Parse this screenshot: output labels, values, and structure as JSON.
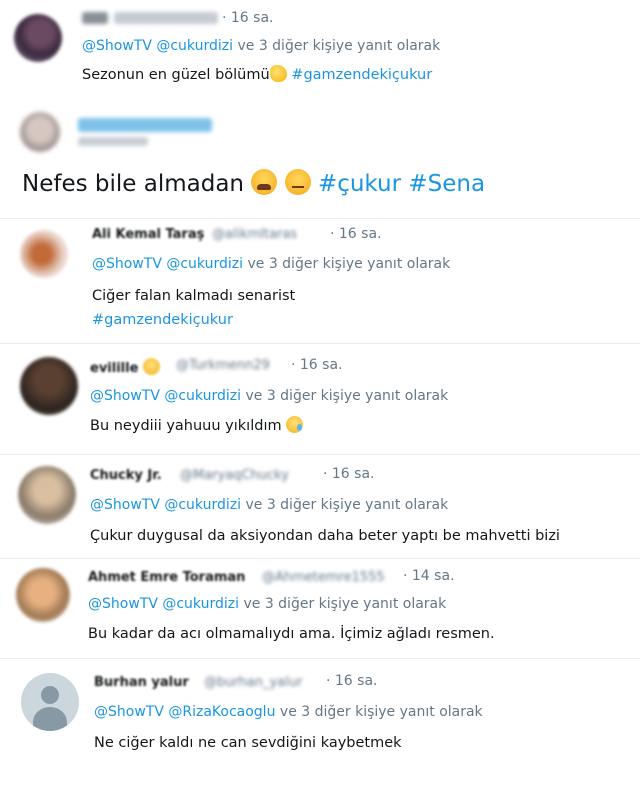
{
  "reply_prefix": "@ShowTV",
  "reply_suffix": "ve 3 diğer kişiye yanıt olarak",
  "tweets": [
    {
      "time": "· 16 sa.",
      "mention2": "@cukurdizi",
      "text": "Sezonun en güzel bölümü",
      "hashtag": "#gamzendekiçukur",
      "emoji": "clapping-hands-icon"
    },
    {
      "text": "Nefes bile almadan",
      "hashtags": [
        "#çukur",
        "#Sena"
      ],
      "emojis": [
        "weary-face-icon",
        "unamused-face-icon"
      ]
    },
    {
      "name": "Ali Kemal Taraş",
      "handle": "@alikmltaras",
      "time": "· 16 sa.",
      "mention2": "@cukurdizi",
      "text": "Ciğer falan kalmadı senarist",
      "hashtag": "#gamzendekiçukur"
    },
    {
      "name": "evilille",
      "handle": "@Turkmenn29",
      "time": "· 16 sa.",
      "mention2": "@cukurdizi",
      "text": "Bu neydiii yahuuu yıkıldım",
      "emoji": "crying-face-icon"
    },
    {
      "name": "Chucky Jr.",
      "handle": "@MaryaqChucky",
      "time": "· 16 sa.",
      "mention2": "@cukurdizi",
      "text": "Çukur duygusal da aksiyondan daha beter yaptı be mahvetti bizi"
    },
    {
      "name": "Ahmet Emre Toraman",
      "handle": "@Ahmetemre1555",
      "time": "· 14 sa.",
      "mention2": "@cukurdizi",
      "text": "Bu kadar da acı olmamalıydı ama. İçimiz ağladı resmen."
    },
    {
      "name": "Burhan yalur",
      "handle": "@burhan_yalur",
      "time": "· 16 sa.",
      "mention2": "@RizaKocaoglu",
      "text": "Ne ciğer kaldı ne can sevdiğini kaybetmek"
    }
  ],
  "colors": {
    "link": "#1b95e0",
    "muted": "#657786",
    "text": "#14171a"
  }
}
